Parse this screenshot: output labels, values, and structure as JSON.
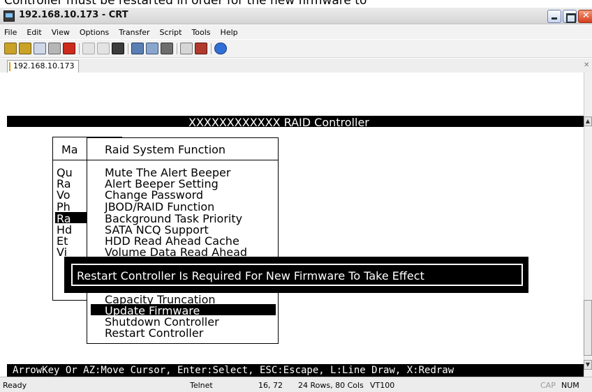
{
  "caption": "Controller must be restarted in order for the new firmware to",
  "window": {
    "title": "192.168.10.173 - CRT"
  },
  "menu": [
    "File",
    "Edit",
    "View",
    "Options",
    "Transfer",
    "Script",
    "Tools",
    "Help"
  ],
  "toolbar": {
    "icons": [
      "connect-icon",
      "quick-connect-icon",
      "connect-tab-icon",
      "reconnect-icon",
      "disconnect-icon",
      "copy-icon",
      "paste-icon",
      "find-icon",
      "print-setup-icon",
      "print-icon",
      "print-screen-icon",
      "session-options-icon",
      "global-options-icon",
      "help-icon"
    ]
  },
  "tab": {
    "label": "192.168.10.173"
  },
  "terminal": {
    "header": "XXXXXXXXXXXX RAID Controller",
    "main_menu": {
      "title": "Ma",
      "items": [
        "Qu",
        "Ra",
        "Vo",
        "Ph",
        "Ra",
        "Hd",
        "Et",
        "Vi"
      ]
    },
    "submenu": {
      "title": "Raid System Function",
      "items": [
        "Mute The Alert Beeper",
        "Alert Beeper Setting",
        "Change Password",
        "JBOD/RAID Function",
        "Background Task Priority",
        "SATA NCQ Support",
        "HDD Read Ahead Cache",
        "Volume Data Read Ahead"
      ],
      "items_below": [
        "Capacity Truncation",
        "Update Firmware",
        "Shutdown Controller",
        "Restart Controller"
      ],
      "selected_index_below": 1
    },
    "message": "Restart Controller Is Required For New Firmware To Take Effect",
    "footer": "ArrowKey Or AZ:Move Cursor, Enter:Select, ESC:Escape, L:Line Draw, X:Redraw"
  },
  "status": {
    "state": "Ready",
    "protocol": "Telnet",
    "cursor": "16, 72",
    "size": "24 Rows, 80 Cols",
    "emulation": "VT100",
    "caps": "CAP",
    "num": "NUM"
  }
}
